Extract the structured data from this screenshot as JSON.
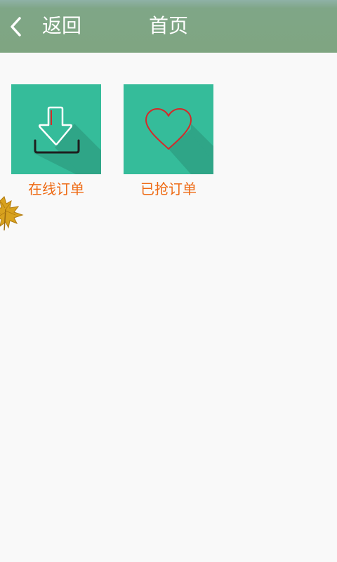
{
  "header": {
    "back_label": "返回",
    "title": "首页"
  },
  "tiles": [
    {
      "label": "在线订单",
      "icon": "download-icon"
    },
    {
      "label": "已抢订单",
      "icon": "heart-icon"
    }
  ],
  "colors": {
    "header_bg": "#7fa581",
    "tile_bg": "#35bc9a",
    "tile_shadow": "#2fa587",
    "label_text": "#ee6a14",
    "heart_stroke": "#d62828",
    "page_bg": "#f9f9f9"
  }
}
